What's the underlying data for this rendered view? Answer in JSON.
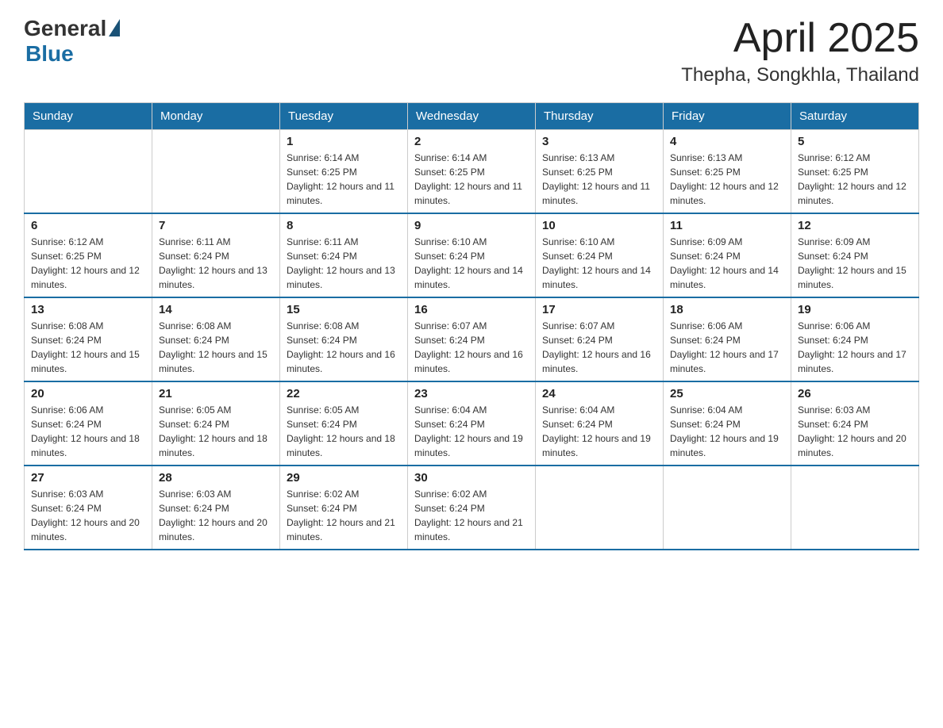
{
  "logo": {
    "general": "General",
    "blue": "Blue"
  },
  "header": {
    "month": "April 2025",
    "location": "Thepha, Songkhla, Thailand"
  },
  "weekdays": [
    "Sunday",
    "Monday",
    "Tuesday",
    "Wednesday",
    "Thursday",
    "Friday",
    "Saturday"
  ],
  "weeks": [
    [
      null,
      null,
      {
        "day": "1",
        "sunrise": "6:14 AM",
        "sunset": "6:25 PM",
        "daylight": "12 hours and 11 minutes."
      },
      {
        "day": "2",
        "sunrise": "6:14 AM",
        "sunset": "6:25 PM",
        "daylight": "12 hours and 11 minutes."
      },
      {
        "day": "3",
        "sunrise": "6:13 AM",
        "sunset": "6:25 PM",
        "daylight": "12 hours and 11 minutes."
      },
      {
        "day": "4",
        "sunrise": "6:13 AM",
        "sunset": "6:25 PM",
        "daylight": "12 hours and 12 minutes."
      },
      {
        "day": "5",
        "sunrise": "6:12 AM",
        "sunset": "6:25 PM",
        "daylight": "12 hours and 12 minutes."
      }
    ],
    [
      {
        "day": "6",
        "sunrise": "6:12 AM",
        "sunset": "6:25 PM",
        "daylight": "12 hours and 12 minutes."
      },
      {
        "day": "7",
        "sunrise": "6:11 AM",
        "sunset": "6:24 PM",
        "daylight": "12 hours and 13 minutes."
      },
      {
        "day": "8",
        "sunrise": "6:11 AM",
        "sunset": "6:24 PM",
        "daylight": "12 hours and 13 minutes."
      },
      {
        "day": "9",
        "sunrise": "6:10 AM",
        "sunset": "6:24 PM",
        "daylight": "12 hours and 14 minutes."
      },
      {
        "day": "10",
        "sunrise": "6:10 AM",
        "sunset": "6:24 PM",
        "daylight": "12 hours and 14 minutes."
      },
      {
        "day": "11",
        "sunrise": "6:09 AM",
        "sunset": "6:24 PM",
        "daylight": "12 hours and 14 minutes."
      },
      {
        "day": "12",
        "sunrise": "6:09 AM",
        "sunset": "6:24 PM",
        "daylight": "12 hours and 15 minutes."
      }
    ],
    [
      {
        "day": "13",
        "sunrise": "6:08 AM",
        "sunset": "6:24 PM",
        "daylight": "12 hours and 15 minutes."
      },
      {
        "day": "14",
        "sunrise": "6:08 AM",
        "sunset": "6:24 PM",
        "daylight": "12 hours and 15 minutes."
      },
      {
        "day": "15",
        "sunrise": "6:08 AM",
        "sunset": "6:24 PM",
        "daylight": "12 hours and 16 minutes."
      },
      {
        "day": "16",
        "sunrise": "6:07 AM",
        "sunset": "6:24 PM",
        "daylight": "12 hours and 16 minutes."
      },
      {
        "day": "17",
        "sunrise": "6:07 AM",
        "sunset": "6:24 PM",
        "daylight": "12 hours and 16 minutes."
      },
      {
        "day": "18",
        "sunrise": "6:06 AM",
        "sunset": "6:24 PM",
        "daylight": "12 hours and 17 minutes."
      },
      {
        "day": "19",
        "sunrise": "6:06 AM",
        "sunset": "6:24 PM",
        "daylight": "12 hours and 17 minutes."
      }
    ],
    [
      {
        "day": "20",
        "sunrise": "6:06 AM",
        "sunset": "6:24 PM",
        "daylight": "12 hours and 18 minutes."
      },
      {
        "day": "21",
        "sunrise": "6:05 AM",
        "sunset": "6:24 PM",
        "daylight": "12 hours and 18 minutes."
      },
      {
        "day": "22",
        "sunrise": "6:05 AM",
        "sunset": "6:24 PM",
        "daylight": "12 hours and 18 minutes."
      },
      {
        "day": "23",
        "sunrise": "6:04 AM",
        "sunset": "6:24 PM",
        "daylight": "12 hours and 19 minutes."
      },
      {
        "day": "24",
        "sunrise": "6:04 AM",
        "sunset": "6:24 PM",
        "daylight": "12 hours and 19 minutes."
      },
      {
        "day": "25",
        "sunrise": "6:04 AM",
        "sunset": "6:24 PM",
        "daylight": "12 hours and 19 minutes."
      },
      {
        "day": "26",
        "sunrise": "6:03 AM",
        "sunset": "6:24 PM",
        "daylight": "12 hours and 20 minutes."
      }
    ],
    [
      {
        "day": "27",
        "sunrise": "6:03 AM",
        "sunset": "6:24 PM",
        "daylight": "12 hours and 20 minutes."
      },
      {
        "day": "28",
        "sunrise": "6:03 AM",
        "sunset": "6:24 PM",
        "daylight": "12 hours and 20 minutes."
      },
      {
        "day": "29",
        "sunrise": "6:02 AM",
        "sunset": "6:24 PM",
        "daylight": "12 hours and 21 minutes."
      },
      {
        "day": "30",
        "sunrise": "6:02 AM",
        "sunset": "6:24 PM",
        "daylight": "12 hours and 21 minutes."
      },
      null,
      null,
      null
    ]
  ]
}
